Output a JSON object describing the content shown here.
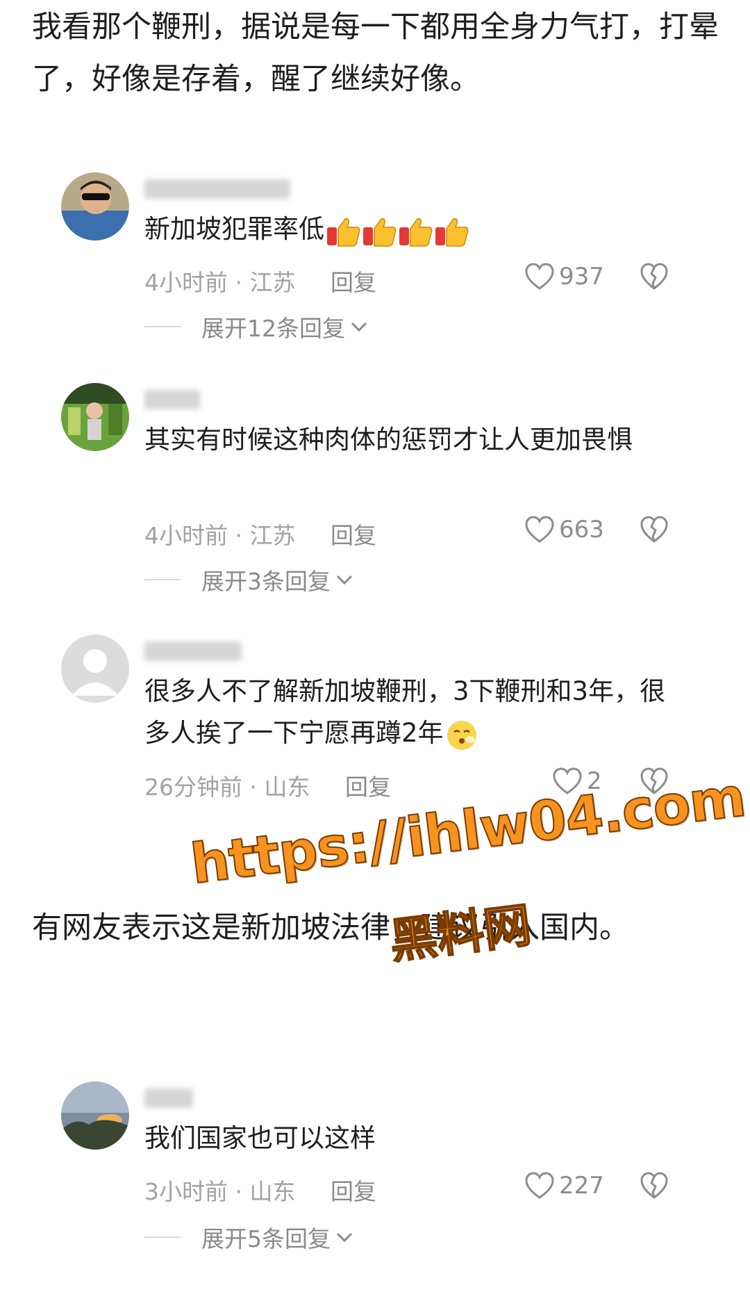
{
  "post": {
    "paragraph_1": "我看那个鞭刑，据说是每一下都用全身力气打，打晕了，好像是存着，醒了继续好像。",
    "paragraph_2": "有网友表示这是新加坡法律，建议引入国内。"
  },
  "comments": [
    {
      "text": "新加坡犯罪率低",
      "emoji": [
        "thumbs-up-icon",
        "thumbs-up-icon",
        "thumbs-up-icon",
        "thumbs-up-icon"
      ],
      "time": "4小时前",
      "location": "江苏",
      "reply_label": "回复",
      "likes": "937",
      "expand_label": "展开12条回复"
    },
    {
      "text": "其实有时候这种肉体的惩罚才让人更加畏惧",
      "time": "4小时前",
      "location": "江苏",
      "reply_label": "回复",
      "likes": "663",
      "expand_label": "展开3条回复"
    },
    {
      "text": "很多人不了解新加坡鞭刑，3下鞭刑和3年，很多人挨了一下宁愿再蹲2年",
      "emoji": [
        "tearful-face-icon"
      ],
      "time": "26分钟前",
      "location": "山东",
      "reply_label": "回复",
      "likes": "2"
    },
    {
      "text": "我们国家也可以这样",
      "time": "3小时前",
      "location": "山东",
      "reply_label": "回复",
      "likes": "227",
      "expand_label": "展开5条回复"
    }
  ],
  "watermark": {
    "url": "https://ihlw04.com",
    "name": "黑料网"
  },
  "colors": {
    "text": "#1e1e1e",
    "meta": "#a2a2a2",
    "watermark": "#f7931e"
  }
}
